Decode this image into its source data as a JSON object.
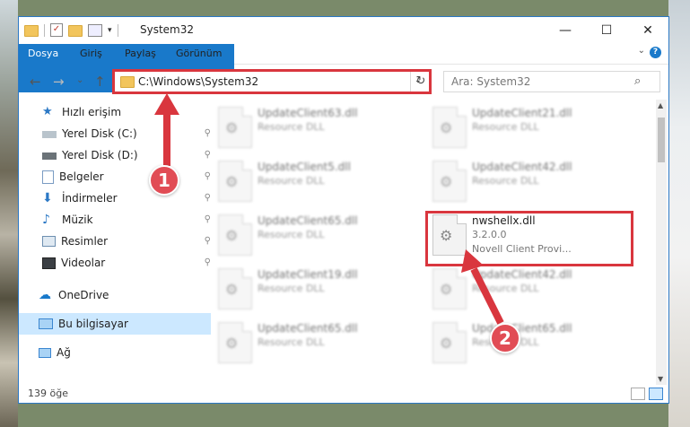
{
  "window": {
    "title": "System32",
    "controls": {
      "minimize": "—",
      "maximize": "☐",
      "close": "✕"
    }
  },
  "ribbon": {
    "tabs": [
      "Dosya",
      "Giriş",
      "Paylaş",
      "Görünüm"
    ]
  },
  "navigation": {
    "back": "←",
    "forward": "→",
    "recent": "⌄",
    "up": "↑",
    "address_path": "C:\\Windows\\System32",
    "refresh": "↻",
    "search_placeholder": "Ara: System32",
    "search_icon": "⌕"
  },
  "sidebar": {
    "items": [
      {
        "label": "Hızlı erişim",
        "icon": "star-icon"
      },
      {
        "label": "Yerel Disk (C:)",
        "icon": "drive-icon",
        "pinned": true
      },
      {
        "label": "Yerel Disk (D:)",
        "icon": "drive-icon",
        "pinned": true
      },
      {
        "label": "Belgeler",
        "icon": "documents-icon",
        "pinned": true
      },
      {
        "label": "İndirmeler",
        "icon": "downloads-icon",
        "pinned": true
      },
      {
        "label": "Müzik",
        "icon": "music-icon",
        "pinned": true
      },
      {
        "label": "Resimler",
        "icon": "pictures-icon",
        "pinned": true
      },
      {
        "label": "Videolar",
        "icon": "videos-icon",
        "pinned": true
      },
      {
        "label": "OneDrive",
        "icon": "cloud-icon"
      },
      {
        "label": "Bu bilgisayar",
        "icon": "computer-icon",
        "selected": true
      },
      {
        "label": "Ağ",
        "icon": "network-icon"
      }
    ],
    "pin_glyph": "📌"
  },
  "files": [
    {
      "name": "UpdateClient63.dll",
      "type": "Resource DLL"
    },
    {
      "name": "UpdateClient21.dll",
      "type": "Resource DLL"
    },
    {
      "name": "UpdateClient5.dll",
      "type": "Resource DLL"
    },
    {
      "name": "UpdateClient42.dll",
      "type": "Resource DLL"
    },
    {
      "name": "UpdateClient65.dll",
      "type": "Resource DLL"
    },
    {
      "name": "nwshellx.dll",
      "version": "3.2.0.0",
      "type": "Novell Client Provi..."
    },
    {
      "name": "UpdateClient19.dll",
      "type": "Resource DLL"
    },
    {
      "name": "UpdateClient42.dll",
      "type": "Resource DLL"
    },
    {
      "name": "UpdateClient65.dll",
      "type": "Resource DLL"
    },
    {
      "name": "UpdateClient65.dll",
      "type": "Resource DLL"
    }
  ],
  "status": {
    "item_count": "139 öğe"
  },
  "annotations": {
    "step1": "1",
    "step2": "2",
    "highlight_color": "#d9363e"
  },
  "colors": {
    "accent": "#1979ca",
    "selection": "#cce8ff"
  }
}
